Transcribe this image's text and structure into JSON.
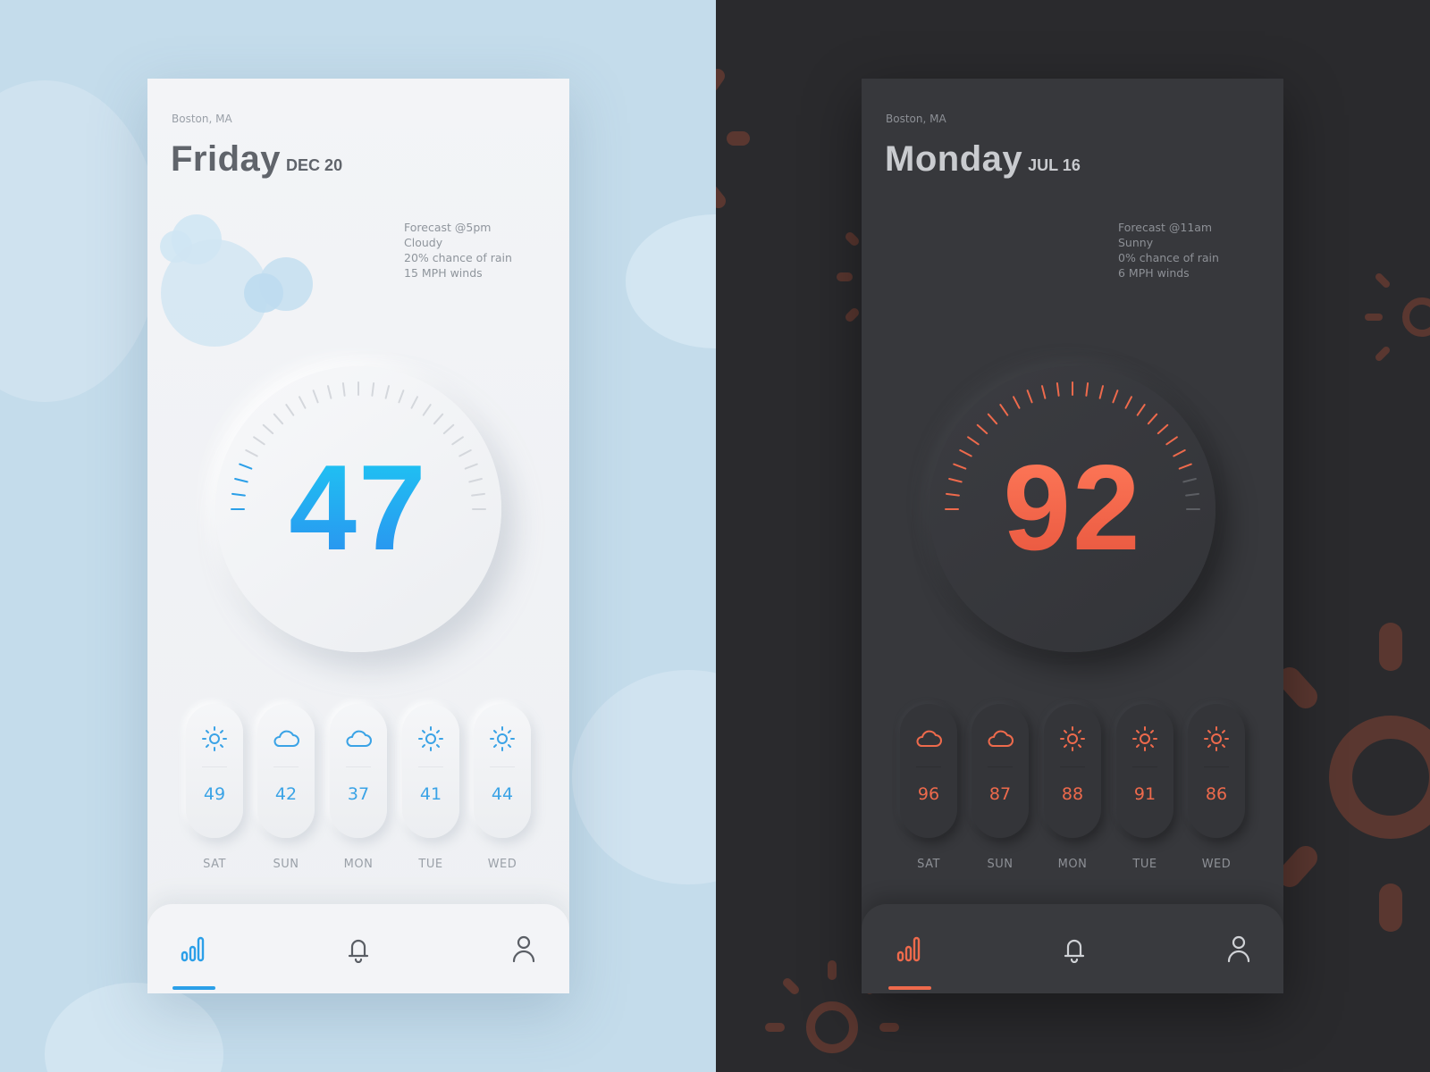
{
  "screens": [
    {
      "theme": "light",
      "location": "Boston, MA",
      "day": "Friday",
      "date": "DEC 20",
      "forecast": {
        "time": "Forecast @5pm",
        "condition": "Cloudy",
        "rain": "20% chance of rain",
        "wind": "15 MPH winds"
      },
      "temperature": "47",
      "forecast_days": [
        {
          "label": "SAT",
          "temp": "49",
          "icon": "sun-icon"
        },
        {
          "label": "SUN",
          "temp": "42",
          "icon": "cloud-icon"
        },
        {
          "label": "MON",
          "temp": "37",
          "icon": "cloud-icon"
        },
        {
          "label": "TUE",
          "temp": "41",
          "icon": "sun-icon"
        },
        {
          "label": "WED",
          "temp": "44",
          "icon": "sun-icon"
        }
      ],
      "nav": [
        "stats-icon",
        "bell-icon",
        "user-icon"
      ],
      "accent": "#2b9fe8"
    },
    {
      "theme": "dark",
      "location": "Boston, MA",
      "day": "Monday",
      "date": "JUL 16",
      "forecast": {
        "time": "Forecast @11am",
        "condition": "Sunny",
        "rain": "0% chance of rain",
        "wind": "6 MPH winds"
      },
      "temperature": "92",
      "forecast_days": [
        {
          "label": "SAT",
          "temp": "96",
          "icon": "cloud-icon"
        },
        {
          "label": "SUN",
          "temp": "87",
          "icon": "cloud-icon"
        },
        {
          "label": "MON",
          "temp": "88",
          "icon": "sun-icon"
        },
        {
          "label": "TUE",
          "temp": "91",
          "icon": "sun-icon"
        },
        {
          "label": "WED",
          "temp": "86",
          "icon": "sun-icon"
        }
      ],
      "nav": [
        "stats-icon",
        "bell-icon",
        "user-icon"
      ],
      "accent": "#ee6a4c"
    }
  ]
}
